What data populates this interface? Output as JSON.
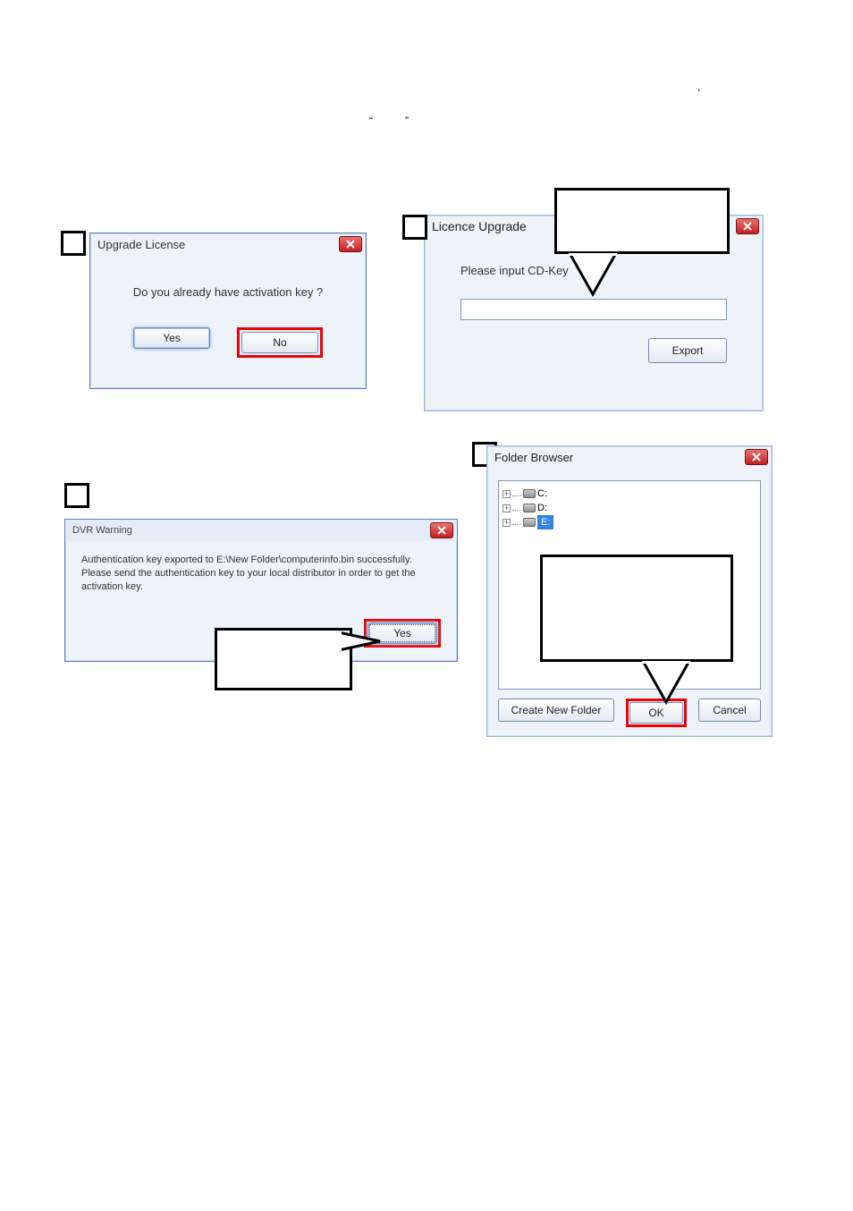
{
  "floating": {
    "comma": ",",
    "lq": "“",
    "rq": "”"
  },
  "dlg1": {
    "title": "Upgrade License",
    "question": "Do you already have activation key ?",
    "yes": "Yes",
    "no": "No"
  },
  "dlg2": {
    "title": "Licence Upgrade",
    "label": "Please input CD-Key",
    "export": "Export"
  },
  "dlg3": {
    "title": "DVR Warning",
    "body": "Authentication key exported to E:\\New Folder\\computerinfo.bin successfully. Please send the authentication key to your local distributor in order to get the activation key.",
    "yes": "Yes"
  },
  "dlg4": {
    "title": "Folder Browser",
    "drives": {
      "c": "C:",
      "d": "D:",
      "e": "E:"
    },
    "create": "Create New Folder",
    "ok": "OK",
    "cancel": "Cancel"
  }
}
